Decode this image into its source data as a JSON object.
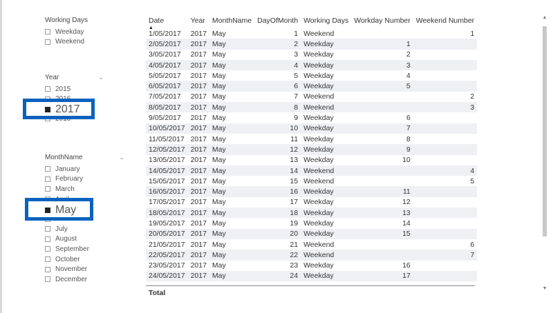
{
  "slicers": {
    "working_days": {
      "title": "Working Days",
      "options": [
        "Weekday",
        "Weekend"
      ]
    },
    "year": {
      "title": "Year",
      "options_above": [
        "2015",
        "2016"
      ],
      "selected": "2017",
      "options_below": [
        "2018"
      ]
    },
    "month": {
      "title": "MonthName",
      "options_above": [
        "January",
        "February",
        "March",
        "April"
      ],
      "selected": "May",
      "options_below": [
        "June",
        "July",
        "August",
        "September",
        "October",
        "November",
        "December"
      ]
    }
  },
  "table": {
    "columns": [
      "Date",
      "Year",
      "MonthName",
      "DayOfMonth",
      "Working Days",
      "Workday Number",
      "Weekend Number"
    ],
    "rows": [
      [
        "1/05/2017",
        "2017",
        "May",
        "1",
        "Weekend",
        "",
        "1"
      ],
      [
        "2/05/2017",
        "2017",
        "May",
        "2",
        "Weekday",
        "1",
        ""
      ],
      [
        "3/05/2017",
        "2017",
        "May",
        "3",
        "Weekday",
        "2",
        ""
      ],
      [
        "4/05/2017",
        "2017",
        "May",
        "4",
        "Weekday",
        "3",
        ""
      ],
      [
        "5/05/2017",
        "2017",
        "May",
        "5",
        "Weekday",
        "4",
        ""
      ],
      [
        "6/05/2017",
        "2017",
        "May",
        "6",
        "Weekday",
        "5",
        ""
      ],
      [
        "7/05/2017",
        "2017",
        "May",
        "7",
        "Weekend",
        "",
        "2"
      ],
      [
        "8/05/2017",
        "2017",
        "May",
        "8",
        "Weekend",
        "",
        "3"
      ],
      [
        "9/05/2017",
        "2017",
        "May",
        "9",
        "Weekday",
        "6",
        ""
      ],
      [
        "10/05/2017",
        "2017",
        "May",
        "10",
        "Weekday",
        "7",
        ""
      ],
      [
        "11/05/2017",
        "2017",
        "May",
        "11",
        "Weekday",
        "8",
        ""
      ],
      [
        "12/05/2017",
        "2017",
        "May",
        "12",
        "Weekday",
        "9",
        ""
      ],
      [
        "13/05/2017",
        "2017",
        "May",
        "13",
        "Weekday",
        "10",
        ""
      ],
      [
        "14/05/2017",
        "2017",
        "May",
        "14",
        "Weekend",
        "",
        "4"
      ],
      [
        "15/05/2017",
        "2017",
        "May",
        "15",
        "Weekend",
        "",
        "5"
      ],
      [
        "16/05/2017",
        "2017",
        "May",
        "16",
        "Weekday",
        "11",
        ""
      ],
      [
        "17/05/2017",
        "2017",
        "May",
        "17",
        "Weekday",
        "12",
        ""
      ],
      [
        "18/05/2017",
        "2017",
        "May",
        "18",
        "Weekday",
        "13",
        ""
      ],
      [
        "19/05/2017",
        "2017",
        "May",
        "19",
        "Weekday",
        "14",
        ""
      ],
      [
        "20/05/2017",
        "2017",
        "May",
        "20",
        "Weekday",
        "15",
        ""
      ],
      [
        "21/05/2017",
        "2017",
        "May",
        "21",
        "Weekend",
        "",
        "6"
      ],
      [
        "22/05/2017",
        "2017",
        "May",
        "22",
        "Weekend",
        "",
        "7"
      ],
      [
        "23/05/2017",
        "2017",
        "May",
        "23",
        "Weekday",
        "16",
        ""
      ],
      [
        "24/05/2017",
        "2017",
        "May",
        "24",
        "Weekday",
        "17",
        ""
      ]
    ],
    "total_label": "Total"
  },
  "highlight_color": "#0a62be"
}
